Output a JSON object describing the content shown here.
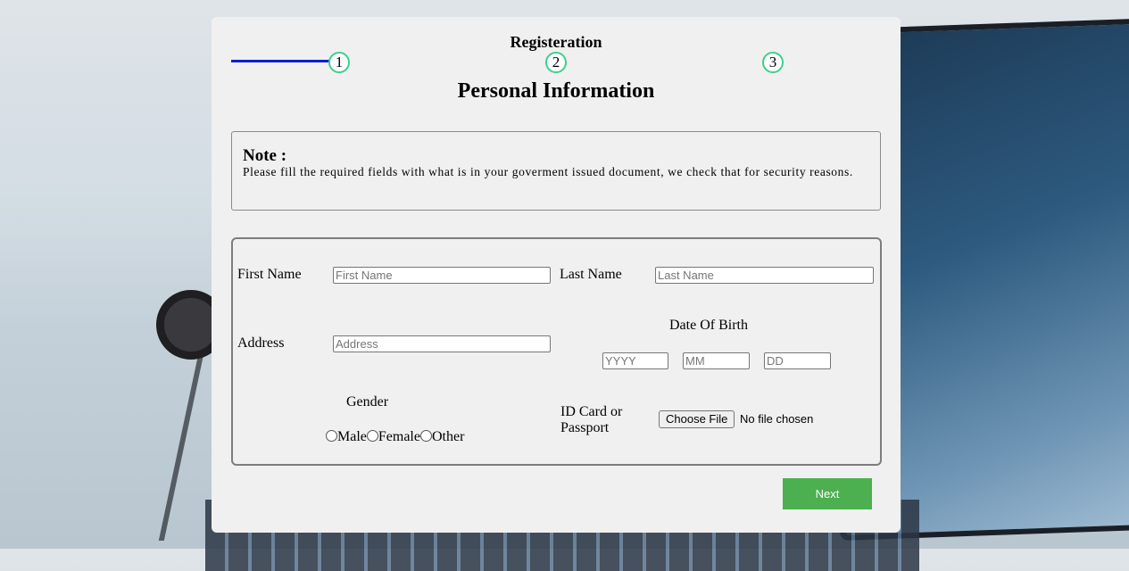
{
  "form": {
    "title": "Registeration",
    "steps": [
      "1",
      "2",
      "3"
    ],
    "current_step": 1,
    "section_title": "Personal Information"
  },
  "note": {
    "heading": "Note :",
    "text": "Please fill the required fields with what is in your goverment issued document, we check that for security reasons."
  },
  "fields": {
    "first_name": {
      "label": "First Name",
      "placeholder": "First Name",
      "value": ""
    },
    "last_name": {
      "label": "Last Name",
      "placeholder": "Last Name",
      "value": ""
    },
    "address": {
      "label": "Address",
      "placeholder": "Address",
      "value": ""
    },
    "dob": {
      "label": "Date Of Birth",
      "year_placeholder": "YYYY",
      "month_placeholder": "MM",
      "day_placeholder": "DD"
    },
    "gender": {
      "label": "Gender",
      "options": [
        "Male",
        "Female",
        "Other"
      ]
    },
    "id_document": {
      "label": "ID Card or Passport",
      "button_label": "Choose File",
      "status": "No file chosen"
    }
  },
  "actions": {
    "next_label": "Next"
  },
  "colors": {
    "progress": "#0a1fd1",
    "step_border": "#3ecf8e",
    "next_button": "#4caf50"
  }
}
